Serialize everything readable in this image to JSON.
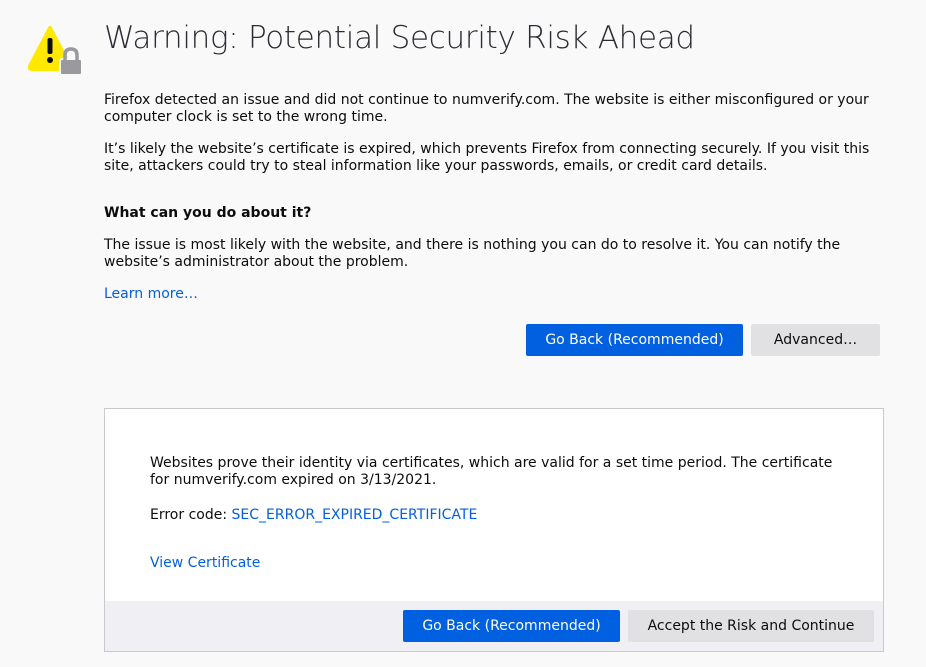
{
  "page": {
    "title": "Warning: Potential Security Risk Ahead",
    "icon": "warning-lock-icon",
    "paragraph1": "Firefox detected an issue and did not continue to numverify.com. The website is either misconfigured or your computer clock is set to the wrong time.",
    "paragraph2": "It’s likely the website’s certificate is expired, which prevents Firefox from connecting securely. If you visit this site, attackers could try to steal information like your passwords, emails, or credit card details.",
    "subheading": "What can you do about it?",
    "paragraph3": "The issue is most likely with the website, and there is nothing you can do to resolve it. You can notify the website’s administrator about the problem.",
    "learn_more": "Learn more…"
  },
  "buttons": {
    "go_back": "Go Back (Recommended)",
    "advanced": "Advanced…"
  },
  "advanced_panel": {
    "description": "Websites prove their identity via certificates, which are valid for a set time period. The certificate for numverify.com expired on 3/13/2021.",
    "error_label": "Error code: ",
    "error_code": "SEC_ERROR_EXPIRED_CERTIFICATE",
    "view_certificate": "View Certificate",
    "go_back": "Go Back (Recommended)",
    "accept": "Accept the Risk and Continue"
  },
  "colors": {
    "accent": "#0060df",
    "warning": "#ffe900",
    "background": "#f9f9fa"
  }
}
